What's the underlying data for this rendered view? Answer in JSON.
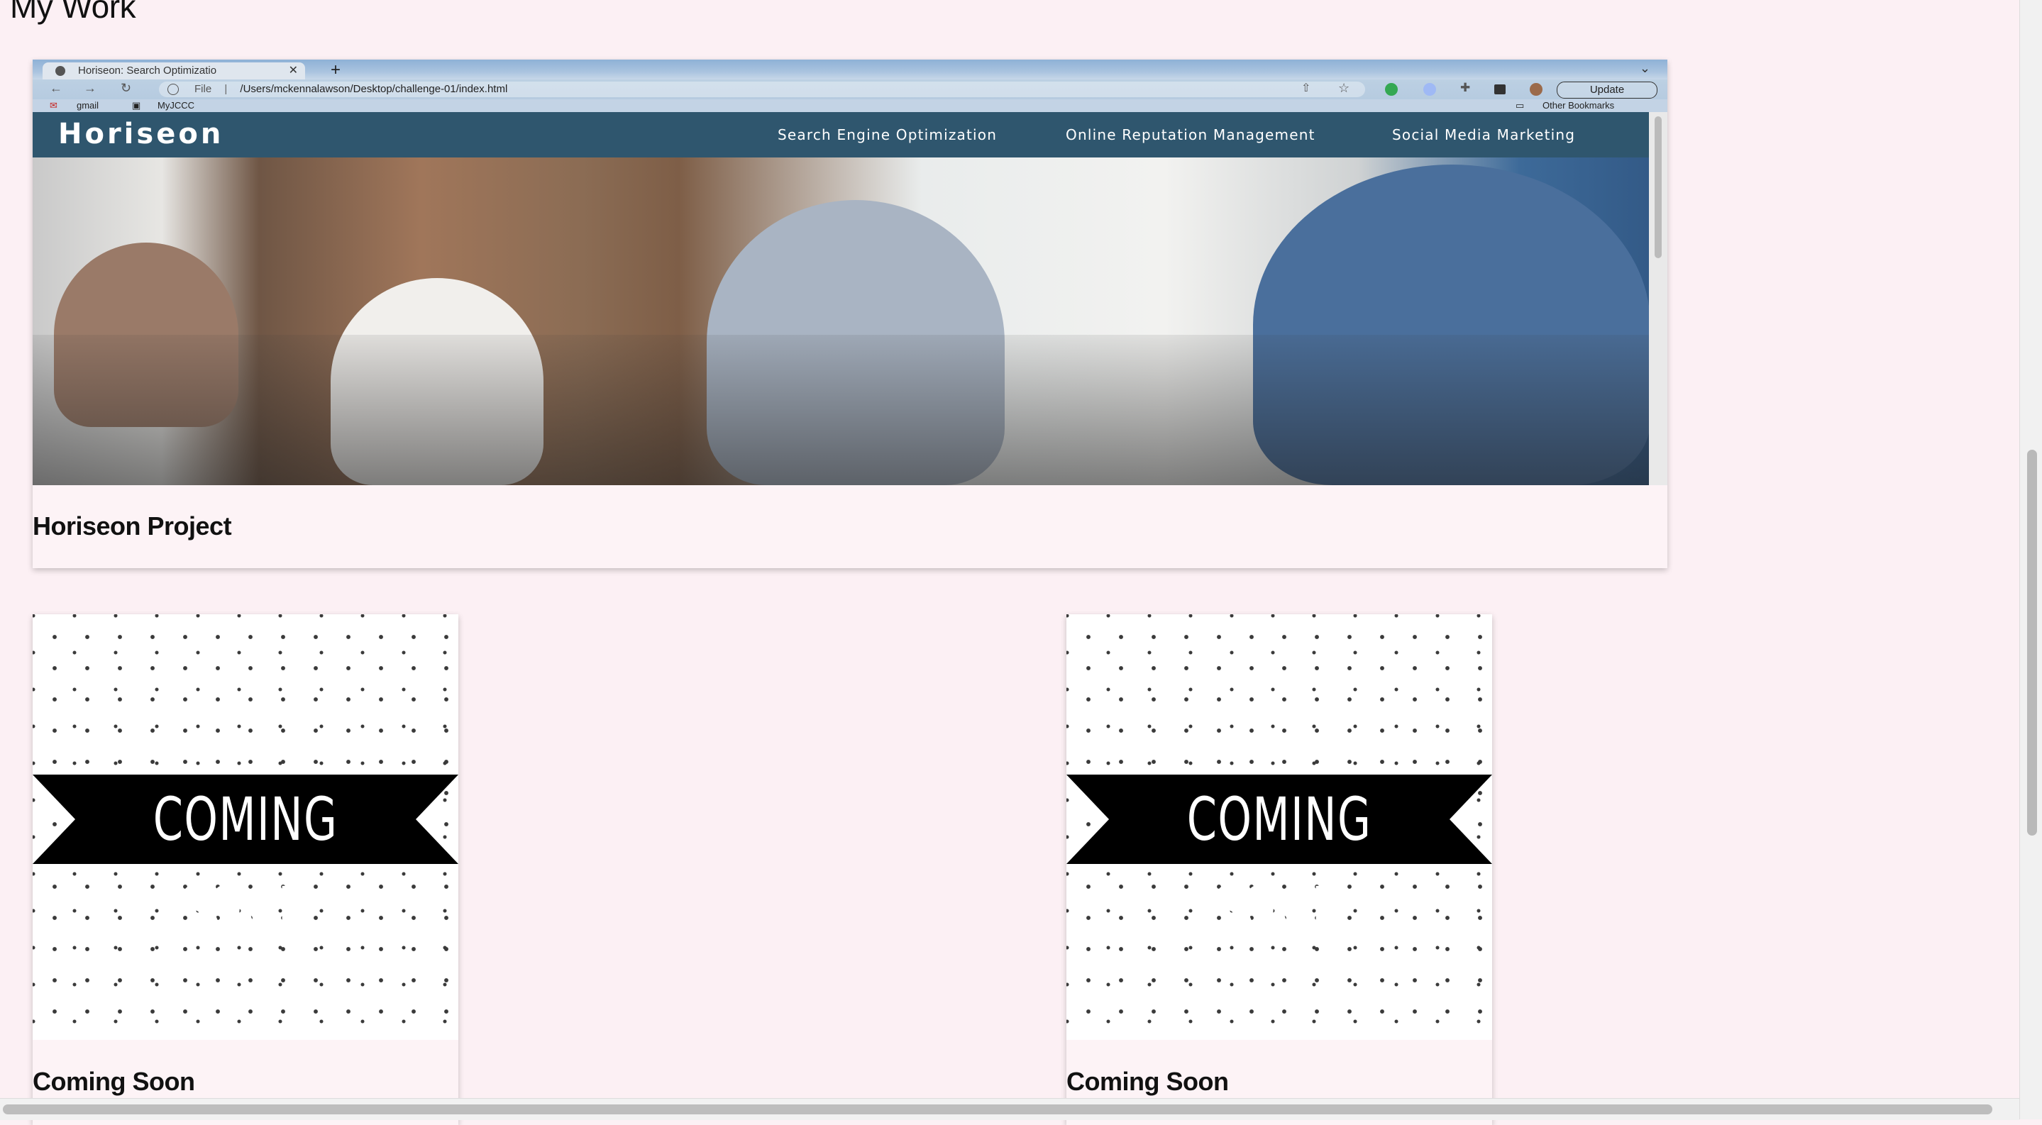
{
  "page": {
    "heading": "My Work"
  },
  "featured": {
    "title": "Horiseon Project",
    "screenshot": {
      "tab_title": "Horiseon: Search Optimizatio",
      "tab_close": "✕",
      "tab_add": "+",
      "url": "/Users/mckennalawson/Desktop/challenge-01/index.html",
      "url_prefix": "File",
      "update_label": "Update",
      "bookmarks": [
        "gmail",
        "MyJCCC"
      ],
      "other_bookmarks": "Other Bookmarks",
      "site_logo": "Horiseon",
      "site_nav": [
        "Search Engine Optimization",
        "Online Reputation Management",
        "Social Media Marketing"
      ]
    }
  },
  "projects": [
    {
      "title": "Coming Soon",
      "banner_text": "COMING SOON"
    },
    {
      "title": "Coming Soon",
      "banner_text": "COMING SOON"
    }
  ],
  "colors": {
    "page_background": "#fcf0f4",
    "site_nav_background": "#2f566e",
    "banner": "#000000"
  }
}
